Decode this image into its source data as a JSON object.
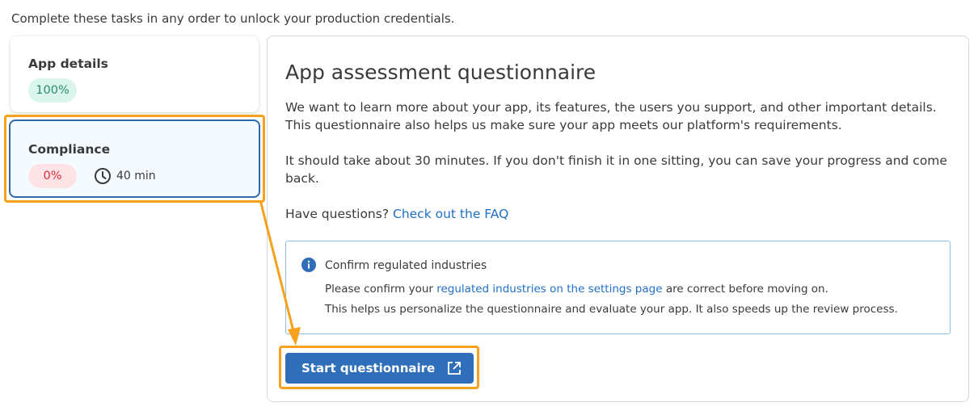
{
  "intro": "Complete these tasks in any order to unlock your production credentials.",
  "tasks": [
    {
      "title": "App details",
      "progress": "100%",
      "progress_color": "#2a8b66"
    },
    {
      "title": "Compliance",
      "progress": "0%",
      "progress_color": "#d52b3e",
      "time": "40 min"
    }
  ],
  "panel": {
    "title": "App assessment questionnaire",
    "para1": "We want to learn more about your app, its features, the users you support, and other important details. This questionnaire also helps us make sure your app meets our platform's requirements.",
    "para2": "It should take about 30 minutes. If you don't finish it in one sitting, you can save your progress and come back.",
    "questions_prefix": "Have questions?",
    "faq_link": "Check out the FAQ",
    "info": {
      "icon": "info-icon",
      "title": "Confirm regulated industries",
      "line1_prefix": "Please confirm your",
      "line1_link": "regulated industries on the settings page",
      "line1_suffix": "are correct before moving on.",
      "line2": "This helps us personalize the questionnaire and evaluate your app. It also speeds up the review process."
    },
    "start_button": "Start questionnaire",
    "start_button_icon": "external-link-icon"
  },
  "colors": {
    "accent": "#2f6fba",
    "highlight": "#f5a11c",
    "link": "#1f6fc5"
  }
}
